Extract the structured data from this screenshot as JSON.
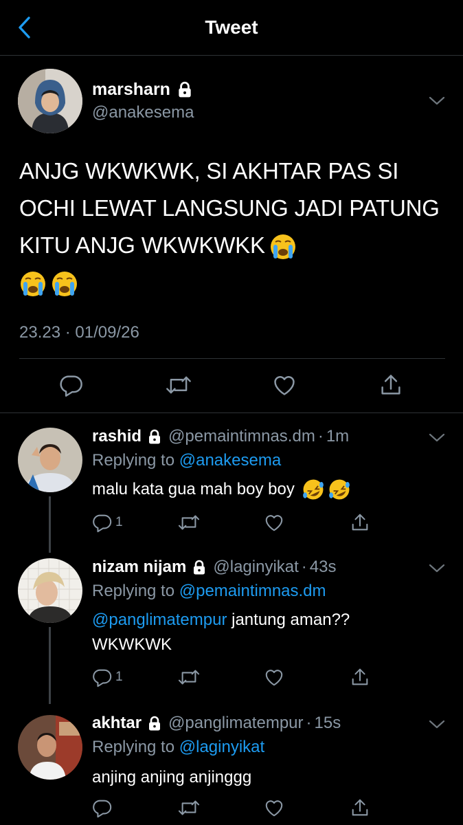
{
  "header": {
    "title": "Tweet"
  },
  "main": {
    "name": "marsharn",
    "handle": "@anakesema",
    "text": "ANJG WKWKWK, SI AKHTAR PAS SI OCHI LEWAT LANGSUNG JADI PATUNG KITU ANJG WKWKWKK",
    "time": "23.23 · 01/09/26",
    "emojis": [
      "loudly-crying-face",
      "loudly-crying-face",
      "loudly-crying-face"
    ]
  },
  "replies": [
    {
      "name": "rashid",
      "handle": "@pemaintimnas.dm",
      "sep": "·",
      "time": "1m",
      "replying_prefix": "Replying to",
      "replying_to": "@anakesema",
      "text": "malu kata gua mah boy boy",
      "reply_count": "1",
      "emojis": [
        "rolling-on-floor-laughing",
        "rolling-on-floor-laughing"
      ]
    },
    {
      "name": "nizam nijam",
      "handle": "@laginyikat",
      "sep": "·",
      "time": "43s",
      "replying_prefix": "Replying to",
      "replying_to": "@pemaintimnas.dm",
      "mention": "@panglimatempur",
      "text": "jantung aman??",
      "text2": "WKWKWK",
      "reply_count": "1"
    },
    {
      "name": "akhtar",
      "handle": "@panglimatempur",
      "sep": "·",
      "time": "15s",
      "replying_prefix": "Replying to",
      "replying_to": "@laginyikat",
      "text": "anjing anjing anjinggg",
      "reply_count": ""
    }
  ],
  "colors": {
    "background": "#000000",
    "text": "#ffffff",
    "muted": "#8b98a5",
    "accent": "#1d9bf0",
    "divider": "#2f3336"
  }
}
